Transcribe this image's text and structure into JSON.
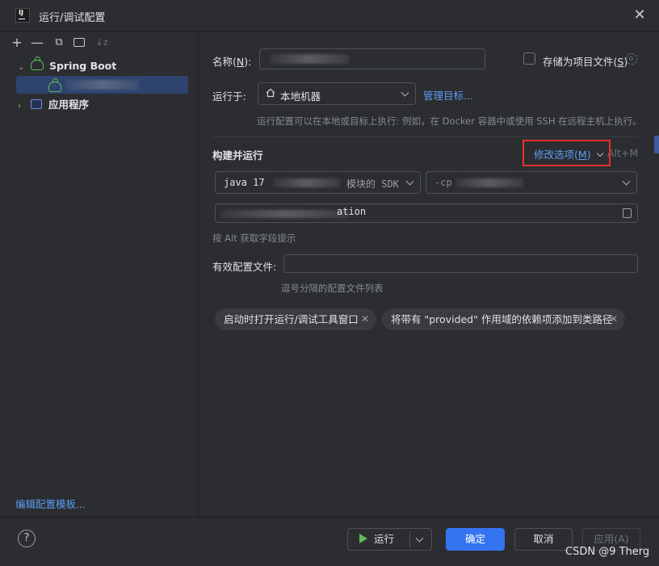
{
  "window": {
    "title": "运行/调试配置",
    "close_icon": "close-icon"
  },
  "sidebar": {
    "toolbar": [
      {
        "name": "add-icon",
        "glyph": "+"
      },
      {
        "name": "remove-icon",
        "glyph": "—"
      },
      {
        "name": "copy-icon",
        "glyph": "⧉"
      },
      {
        "name": "new-folder-icon",
        "glyph": "📁"
      },
      {
        "name": "sort-icon",
        "glyph": "↓z"
      }
    ],
    "tree": {
      "spring_boot_label": "Spring Boot",
      "application_label": "应用程序"
    },
    "edit_templates_link": "编辑配置模板..."
  },
  "form": {
    "name_label": "名称(N):",
    "name_label_plain": "名称(",
    "name_label_key": "N",
    "name_label_tail": "):",
    "store_label_plain": "存储为项目文件(",
    "store_label_key": "S",
    "store_label_tail": ")",
    "run_on_label": "运行于:",
    "run_on_value": "本地机器",
    "manage_targets_link": "管理目标...",
    "run_on_hint": "运行配置可以在本地或目标上执行: 例如，在 Docker 容器中或使用 SSH 在远程主机上执行。",
    "build_run_section": "构建并运行",
    "modify_options_plain": "修改选项(",
    "modify_options_key": "M",
    "modify_options_tail": ")",
    "modify_options_shortcut": "Alt+M",
    "jdk_prefix": "java 17",
    "jdk_suffix": "模块的 SDK",
    "cp_prefix": "-cp",
    "main_class_partial": "ation",
    "field_hint": "按 Alt 获取字段提示",
    "profiles_label": "有效配置文件:",
    "profiles_value": "",
    "profiles_hint": "逗号分隔的配置文件列表",
    "chips": [
      "启动时打开运行/调试工具窗口",
      "将带有 \"provided\" 作用域的依赖项添加到类路径"
    ]
  },
  "footer": {
    "help_glyph": "?",
    "run_label": "运行",
    "ok_label": "确定",
    "cancel_label": "取消",
    "apply_label": "应用(A)"
  },
  "watermark": "CSDN @9 Therg",
  "colors": {
    "accent": "#3574f0",
    "link": "#5b9cf3",
    "highlight_box": "#e5312c",
    "spring": "#5fb85a"
  }
}
